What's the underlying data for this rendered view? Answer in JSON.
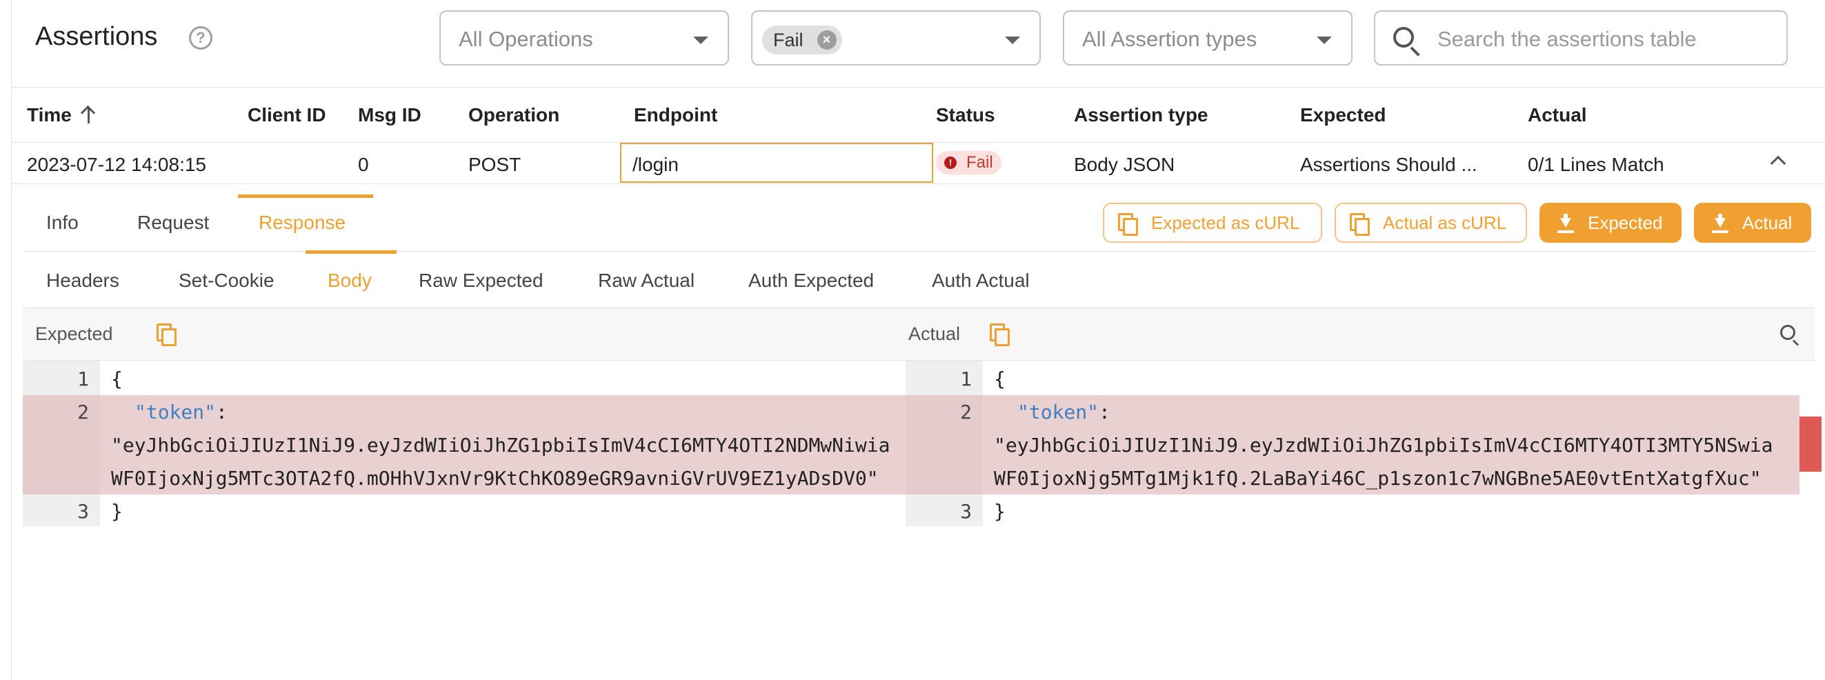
{
  "header": {
    "title": "Assertions",
    "operations_placeholder": "All Operations",
    "status_chip": "Fail",
    "assertion_types_placeholder": "All Assertion types",
    "search_placeholder": "Search the assertions table"
  },
  "table": {
    "columns": [
      "Time",
      "Client ID",
      "Msg ID",
      "Operation",
      "Endpoint",
      "Status",
      "Assertion type",
      "Expected",
      "Actual"
    ],
    "rows": [
      {
        "time": "2023-07-12 14:08:15",
        "client_id": "",
        "msg_id": "0",
        "operation": "POST",
        "endpoint": "/login",
        "status": "Fail",
        "assertion_type": "Body JSON",
        "expected": "Assertions Should ...",
        "actual": "0/1 Lines Match"
      }
    ]
  },
  "detail": {
    "tabs": [
      "Info",
      "Request",
      "Response"
    ],
    "active_tab": "Response",
    "buttons": {
      "expected_curl": "Expected as cURL",
      "actual_curl": "Actual as cURL",
      "expected": "Expected",
      "actual": "Actual"
    },
    "subtabs": [
      "Headers",
      "Set-Cookie",
      "Body",
      "Raw Expected",
      "Raw Actual",
      "Auth Expected",
      "Auth Actual"
    ],
    "active_subtab": "Body"
  },
  "diff": {
    "expected_label": "Expected",
    "actual_label": "Actual",
    "line_numbers": [
      "1",
      "2",
      "3"
    ],
    "open_brace": "{",
    "close_brace": "}",
    "key": "\"token\"",
    "colon": ":",
    "expected_value_line1": "\"eyJhbGciOiJIUzI1NiJ9.eyJzdWIiOiJhZG1pbiIsImV4cCI6MTY4OTI2NDMwNiwia",
    "expected_value_line2": "WF0IjoxNjg5MTc3OTA2fQ.mOHhVJxnVr9KtChKO89eGR9avniGVrUV9EZ1yADsDV0\"",
    "actual_value_line1": "\"eyJhbGciOiJIUzI1NiJ9.eyJzdWIiOiJhZG1pbiIsImV4cCI6MTY4OTI3MTY5NSwia",
    "actual_value_line2": "WF0IjoxNjg5MTg1Mjk1fQ.2LaBaYi46C_p1szon1c7wNGBne5AE0vtEntXatgfXuc\""
  },
  "colors": {
    "accent": "#f0a030",
    "fail_text": "#c0392b",
    "diff_bg": "#e9d0d1",
    "json_key": "#3f7fc2"
  }
}
